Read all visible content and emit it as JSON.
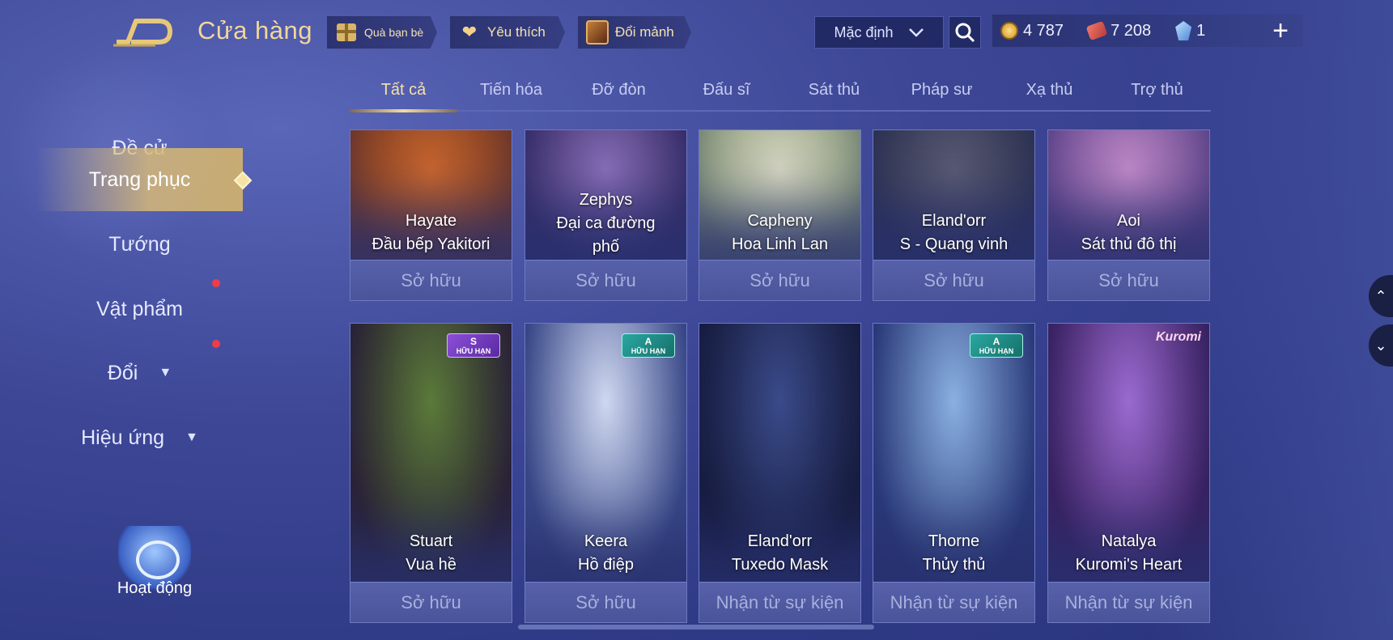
{
  "header": {
    "title": "Cửa hàng",
    "friend_gift": "Quà bạn bè",
    "favorites": "Yêu thích",
    "exchange_fragments": "Đổi mảnh",
    "sort_value": "Mặc định",
    "currencies": {
      "gold": "4 787",
      "vouchers": "7 208",
      "gems": "1"
    }
  },
  "sidebar": {
    "items": [
      {
        "label": "Đề cử"
      },
      {
        "label": "Trang phục"
      },
      {
        "label": "Tướng"
      },
      {
        "label": "Vật phẩm"
      },
      {
        "label": "Đổi"
      },
      {
        "label": "Hiệu ứng"
      }
    ],
    "activity_label": "Hoạt động"
  },
  "tabs": [
    "Tất cả",
    "Tiến hóa",
    "Đỡ đòn",
    "Đấu sĩ",
    "Sát thủ",
    "Pháp sư",
    "Xạ thủ",
    "Trợ thủ"
  ],
  "row1": [
    {
      "hero": "Hayate",
      "skin": "Đầu bếp Yakitori",
      "status": "Sở hữu",
      "color1": "#c9662e",
      "color2": "#7a3a22"
    },
    {
      "hero": "Zephys",
      "skin": "Đại ca đường phố",
      "status": "Sở hữu",
      "color1": "#8a6fb8",
      "color2": "#3a2f6a"
    },
    {
      "hero": "Capheny",
      "skin": "Hoa Linh Lan",
      "status": "Sở hữu",
      "color1": "#d6d6c2",
      "color2": "#8a9a7a"
    },
    {
      "hero": "Eland'orr",
      "skin": "S - Quang vinh",
      "status": "Sở hữu",
      "color1": "#5a5a74",
      "color2": "#2e3350"
    },
    {
      "hero": "Aoi",
      "skin": "Sát thủ đô thị",
      "status": "Sở hữu",
      "color1": "#c08ac8",
      "color2": "#6a4a90"
    }
  ],
  "row2": [
    {
      "hero": "Stuart",
      "skin": "Vua hề",
      "status": "Sở hữu",
      "badge_rank": "S",
      "badge_text": "HỮU HẠN",
      "color1": "#5a7a3a",
      "color2": "#2a2030"
    },
    {
      "hero": "Keera",
      "skin": "Hồ điệp",
      "status": "Sở hữu",
      "badge_rank": "A",
      "badge_text": "HỮU HẠN",
      "color1": "#cfd8f0",
      "color2": "#3a4a8a"
    },
    {
      "hero": "Eland'orr",
      "skin": "Tuxedo Mask",
      "status": "Nhận từ sự kiện",
      "color1": "#3a4a8a",
      "color2": "#151a3a"
    },
    {
      "hero": "Thorne",
      "skin": "Thủy thủ",
      "status": "Nhận từ sự kiện",
      "badge_rank": "A",
      "badge_text": "HỮU HẠN",
      "color1": "#8ab0e0",
      "color2": "#2a3a7a"
    },
    {
      "hero": "Natalya",
      "skin": "Kuromi's Heart",
      "status": "Nhận từ sự kiện",
      "logo": "Kuromi",
      "color1": "#9a6ad0",
      "color2": "#3a2060"
    }
  ]
}
